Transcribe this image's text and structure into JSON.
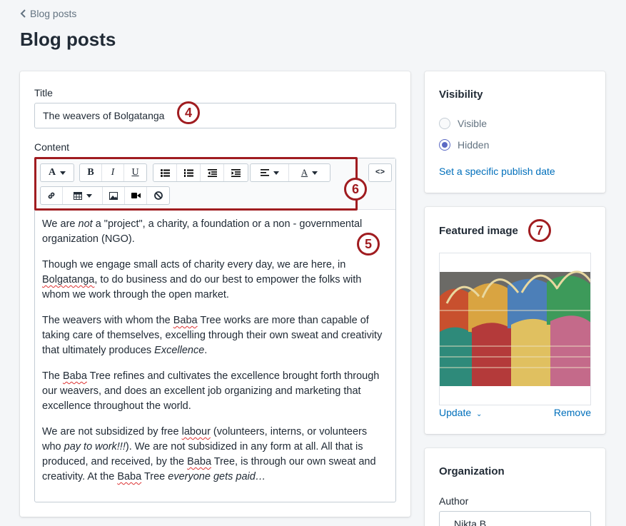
{
  "nav": {
    "back_label": "Blog posts"
  },
  "page": {
    "title": "Blog posts"
  },
  "post": {
    "title_label": "Title",
    "title_value": "The weavers of Bolgatanga",
    "content_label": "Content"
  },
  "toolbar": {
    "font_label": "A",
    "bold_label": "B",
    "italic_label": "I",
    "underline_label": "U",
    "text_color_label": "A",
    "code_label": "<>"
  },
  "content": {
    "p1a": "We are ",
    "p1b": "not",
    "p1c": " a \"project\", a charity, a foundation or a non - governmental organization (NGO).",
    "p2a": "Though we engage small acts of charity every day, we are here, in ",
    "p2b": "Bolgatanga",
    "p2c": ", to do business and do our best to empower the folks with whom we work through the open market.",
    "p3a": "The weavers with whom the ",
    "p3b": "Baba",
    "p3c": " Tree works are more than capable of taking care of themselves, excelling through their own sweat and creativity that ultimately produces ",
    "p3d": "Excellence",
    "p3e": ".",
    "p4a": "The ",
    "p4b": "Baba",
    "p4c": " Tree refines and cultivates the excellence brought forth through our weavers, and does an excellent job organizing and marketing that excellence throughout the world.",
    "p5a": "We are not subsidized by free ",
    "p5b": "labour",
    "p5c": " (volunteers, interns, or volunteers who ",
    "p5d": "pay to work!!!",
    "p5e": "). We are not subsidized in any form at all. All that is produced, and received, by the ",
    "p5f": "Baba",
    "p5g": " Tree, is through our own sweat and creativity. At the ",
    "p5h": "Baba",
    "p5i": " Tree ",
    "p5j": "everyone gets paid…"
  },
  "visibility": {
    "title": "Visibility",
    "visible_label": "Visible",
    "hidden_label": "Hidden",
    "selected": "Hidden",
    "publish_link": "Set a specific publish date"
  },
  "featured": {
    "title": "Featured image",
    "update_label": "Update",
    "remove_label": "Remove"
  },
  "organization": {
    "title": "Organization",
    "author_label": "Author",
    "author_value": "Nikta B."
  },
  "badges": {
    "b4": "4",
    "b5": "5",
    "b6": "6",
    "b7": "7"
  },
  "colors": {
    "accent": "#006fbb",
    "annotation": "#a01c20",
    "radio": "#5c6ac4"
  }
}
